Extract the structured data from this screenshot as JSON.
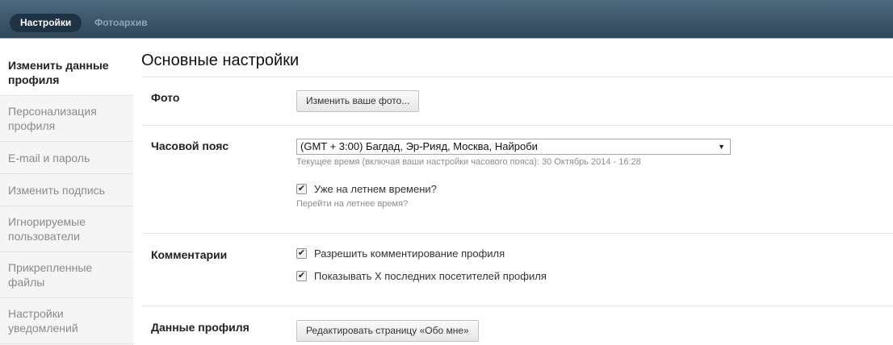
{
  "topnav": {
    "tabs": [
      {
        "label": "Настройки",
        "active": true
      },
      {
        "label": "Фотоархив",
        "active": false
      }
    ]
  },
  "sidebar": {
    "items": [
      {
        "label": "Изменить данные профиля",
        "active": true
      },
      {
        "label": "Персонализация профиля",
        "active": false
      },
      {
        "label": "E-mail и пароль",
        "active": false
      },
      {
        "label": "Изменить подпись",
        "active": false
      },
      {
        "label": "Игнорируемые пользователи",
        "active": false
      },
      {
        "label": "Прикрепленные файлы",
        "active": false
      },
      {
        "label": "Настройки уведомлений",
        "active": false
      }
    ]
  },
  "main": {
    "title": "Основные настройки",
    "photo": {
      "label": "Фото",
      "button": "Изменить ваше фото..."
    },
    "timezone": {
      "label": "Часовой пояс",
      "selected": "(GMT + 3:00) Багдад, Эр-Рияд, Москва, Найроби",
      "current_time_hint": "Текущее время (включая ваши настройки часового пояса): 30 Октябрь 2014 - 16:28",
      "dst_checkbox": {
        "label": "Уже на летнем времени?",
        "checked": true
      },
      "dst_hint": "Перейти на летнее время?"
    },
    "comments": {
      "label": "Комментарии",
      "options": [
        {
          "label": "Разрешить комментирование профиля",
          "checked": true
        },
        {
          "label": "Показывать X последних посетителей профиля",
          "checked": true
        }
      ]
    },
    "profile_data": {
      "label": "Данные профиля",
      "button": "Редактировать страницу «Обо мне»"
    }
  },
  "icons": {
    "checkmark": "✔",
    "dropdown_arrow": "▼"
  },
  "colors": {
    "nav_bar": "#3c5568",
    "active_tab": "#1f3344",
    "inactive_tab_text": "#8fa6b7",
    "sidebar_bg": "#f5f5f5",
    "hint_text": "#8c8c8c"
  }
}
